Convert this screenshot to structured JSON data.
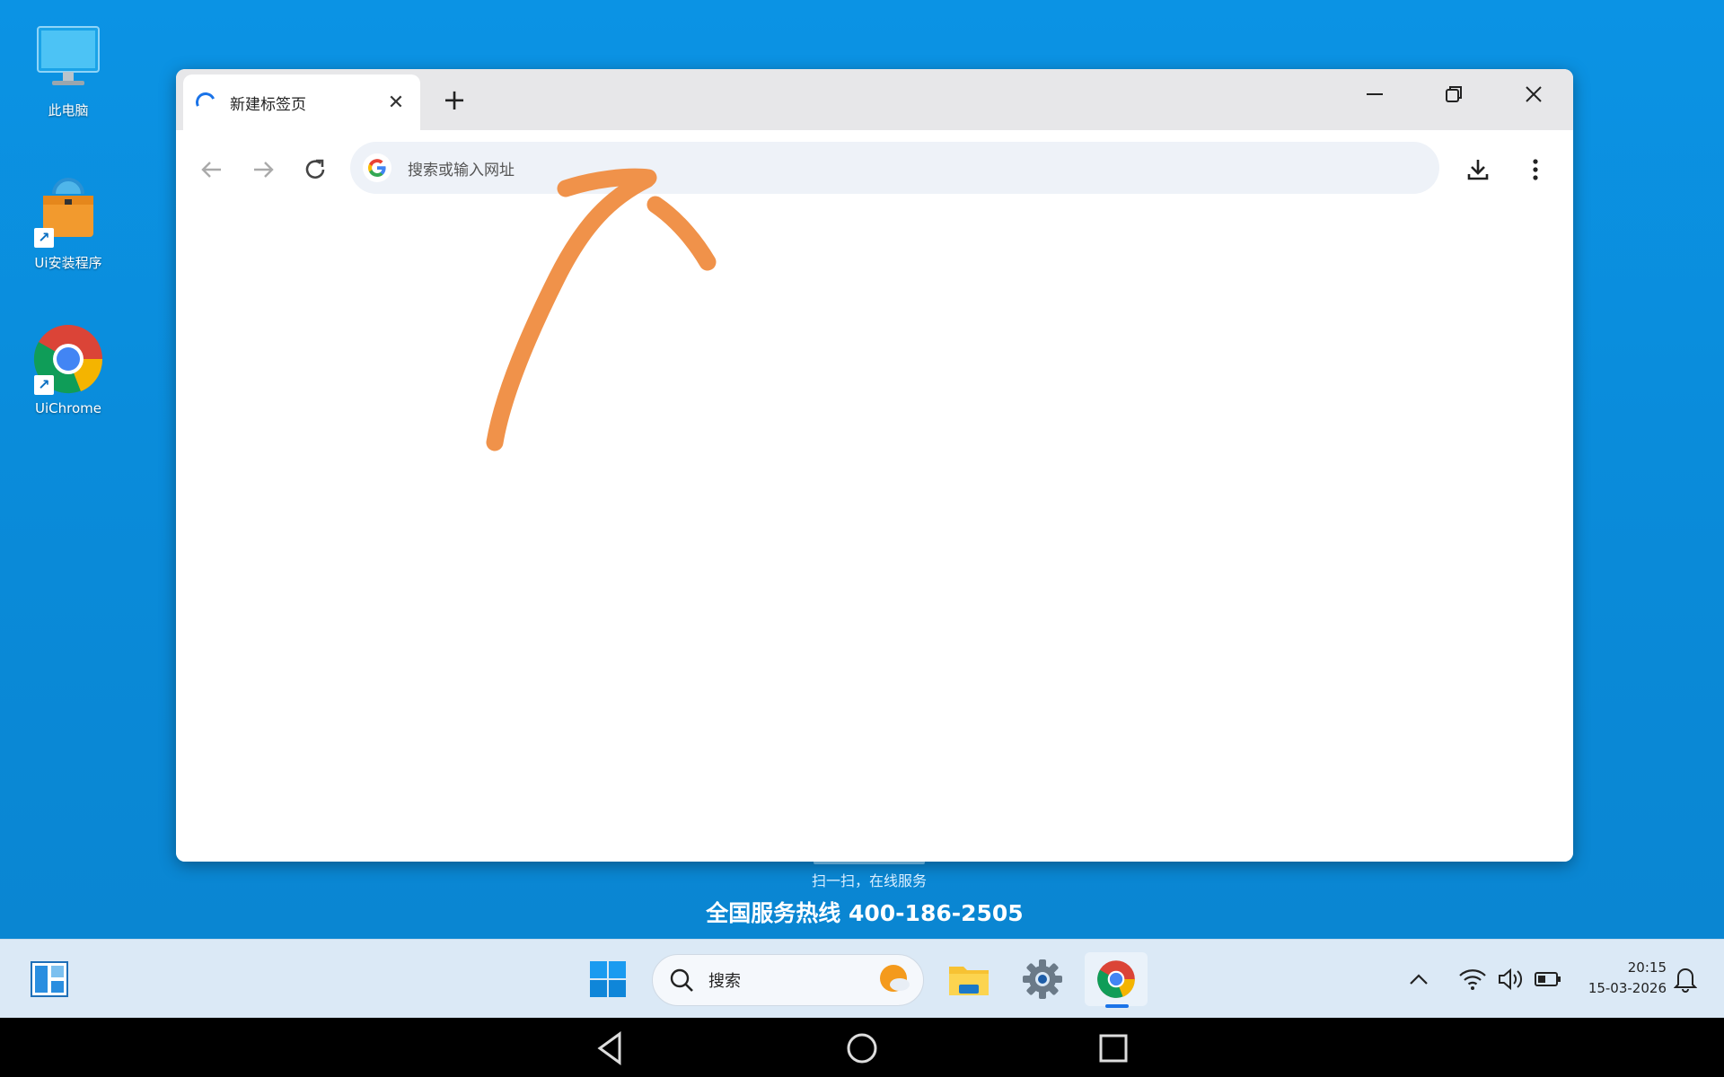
{
  "desktop": {
    "icons": [
      {
        "label": "此电脑"
      },
      {
        "label": "Ui安装程序"
      },
      {
        "label": "UiChrome"
      }
    ],
    "hotline_caption": "扫一扫，在线服务",
    "hotline": "全国服务热线 400-186-2505"
  },
  "browser": {
    "tab_title": "新建标签页",
    "omnibox_placeholder": "搜索或输入网址"
  },
  "taskbar": {
    "search_label": "搜索",
    "time": "20:15",
    "date": "15-03-2026"
  },
  "colors": {
    "desktop_bg": "#0a8fdc",
    "annotation": "#f0924a",
    "accent": "#1a73e8"
  }
}
